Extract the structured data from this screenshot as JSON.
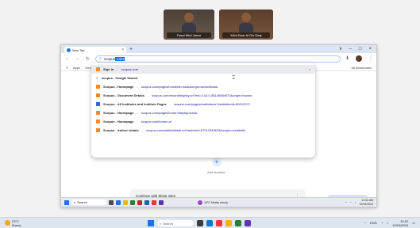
{
  "participants": [
    {
      "name": "Fazal Mhd Jarrar"
    },
    {
      "name": "Mhd Eisar Al Din Diraj"
    }
  ],
  "browser": {
    "tab_title": "New Tab",
    "new_tab_label": "+",
    "window_controls": [
      "v",
      "–",
      "□",
      "×"
    ],
    "omnibox_prefix": "scopus",
    "omnibox_selected": ".com",
    "bookmarks_left": [
      "Apps",
      "Gmail"
    ],
    "bookmarks_right": "All Bookmarks"
  },
  "suggestions": [
    {
      "icon": "orange",
      "title": "Sign in",
      "url": "scopus.com",
      "active": true
    },
    {
      "icon": "search",
      "title": "scopus - Google Search",
      "url": ""
    },
    {
      "icon": "orange",
      "title": "Scopus - Homepage",
      "url": "scopus.com/pages/home#sl=nosb&origin=searchbasic"
    },
    {
      "icon": "orange",
      "title": "Scopus - Document Details",
      "url": "scopus.com/record/display.uri?eid=2-s2.0-85149584673&origin=inward"
    },
    {
      "icon": "blue",
      "title": "Scopus - All Institutes and Institute Pages",
      "url": "scopus.com/pages/institutions?institutionId=60013372"
    },
    {
      "icon": "orange",
      "title": "Scopus - Homepage",
      "url": "scopus.com/pages/home?display=basic"
    },
    {
      "icon": "orange",
      "title": "Scopus - Homepage",
      "url": "scopus.com/home.uri"
    },
    {
      "icon": "orange",
      "title": "Scopus - Author details",
      "url": "scopus.com/authid/detail.uri?authorId=57212345678&origin=resultslist"
    }
  ],
  "page": {
    "add_shortcut": "Add shortcut",
    "continue_label": "Continue with these sites",
    "customize_label": "Customize Chrome"
  },
  "inner_taskbar": {
    "search_label": "Search",
    "weather_temp": "16°C",
    "weather_desc": "Mostly cloudy",
    "time": "11:02 AM",
    "date": "12/04/2024"
  },
  "host_taskbar": {
    "weather_temp": "23°C",
    "weather_desc": "Sunny",
    "search_label": "Search",
    "lang": "ENG",
    "time": "14:02",
    "date": "12/04/2024"
  },
  "colors": {
    "accent": "#1a73e8",
    "scopus_orange": "#f28b30"
  }
}
